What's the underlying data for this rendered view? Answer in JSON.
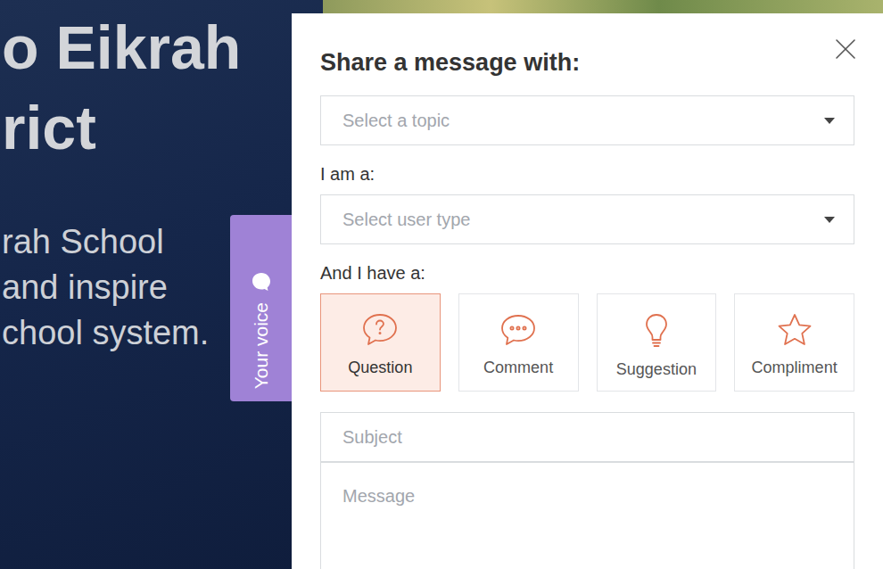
{
  "hero": {
    "heading": [
      "o Eikrah",
      "rict"
    ],
    "body": [
      "rah School",
      "and inspire",
      "chool system."
    ]
  },
  "feedback_tab": {
    "label": "Your voice"
  },
  "panel": {
    "title": "Share a message with:"
  },
  "topic": {
    "placeholder": "Select a topic"
  },
  "user_type": {
    "label": "I am a:",
    "placeholder": "Select user type"
  },
  "message_type": {
    "label": "And I have a:",
    "options": [
      {
        "label": "Question",
        "selected": true
      },
      {
        "label": "Comment",
        "selected": false
      },
      {
        "label": "Suggestion",
        "selected": false
      },
      {
        "label": "Compliment",
        "selected": false
      }
    ]
  },
  "subject": {
    "placeholder": "Subject"
  },
  "message": {
    "placeholder": "Message"
  }
}
